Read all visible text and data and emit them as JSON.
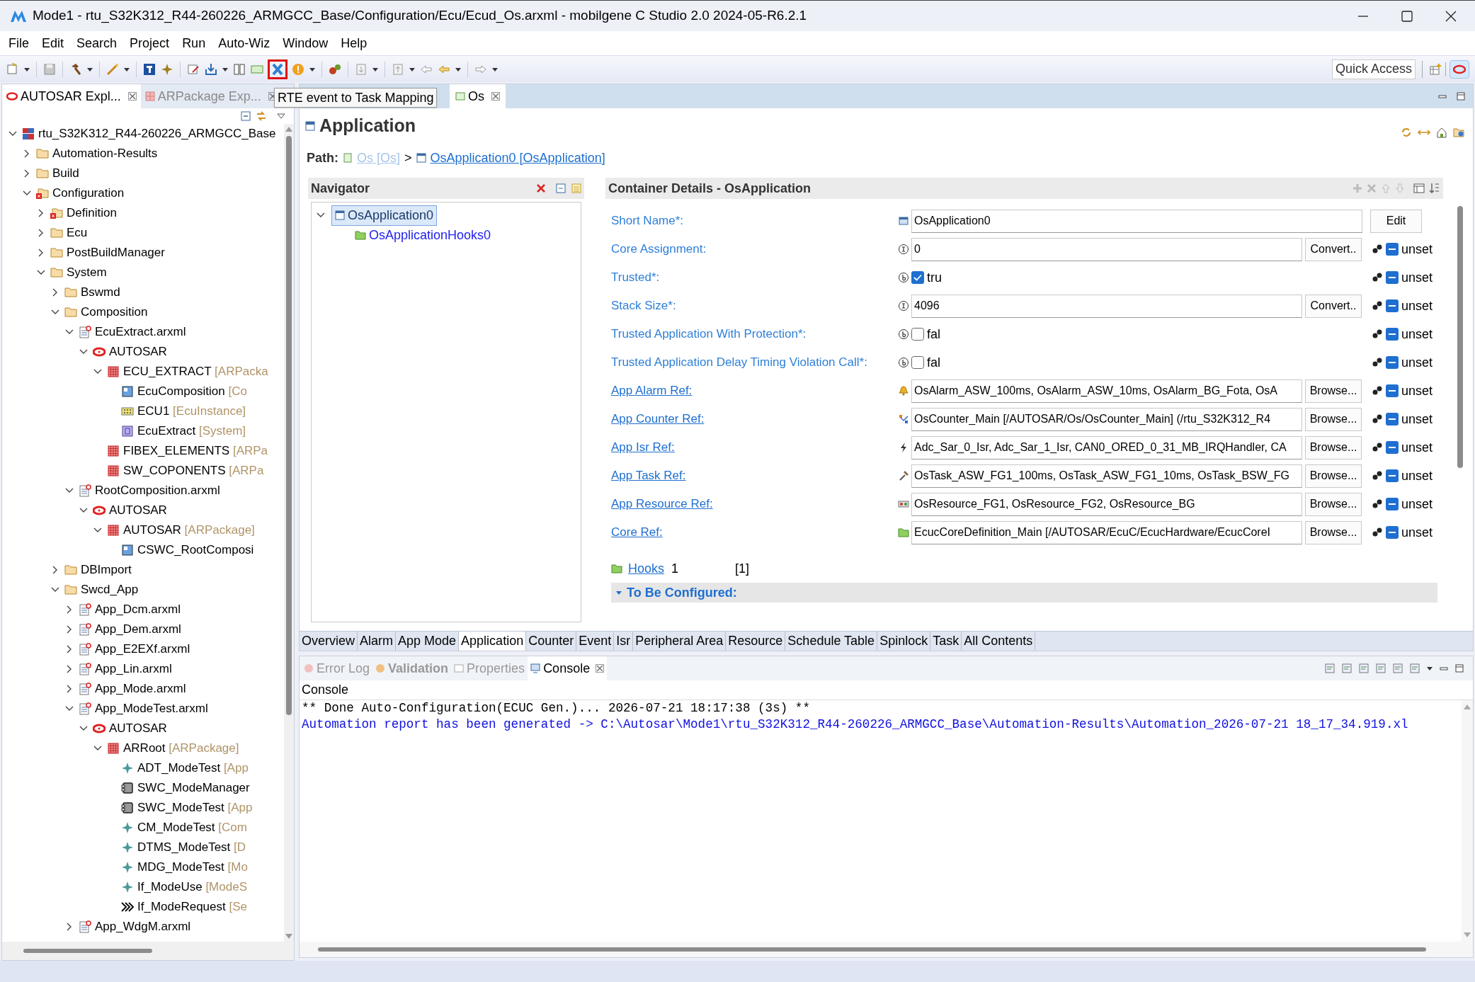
{
  "window": {
    "title": "Mode1 - rtu_S32K312_R44-260226_ARMGCC_Base/Configuration/Ecu/Ecud_Os.arxml - mobilgene C Studio 2.0 2024-05-R6.2.1"
  },
  "menu": [
    "File",
    "Edit",
    "Search",
    "Project",
    "Run",
    "Auto-Wiz",
    "Window",
    "Help"
  ],
  "toolbar": {
    "tooltip": "RTE event to Task Mapping",
    "mapping_tool_highlighted": true,
    "quick_access": "Quick Access"
  },
  "left_tabs": [
    {
      "label": "AUTOSAR Expl...",
      "selected": true
    },
    {
      "label": "ARPackage Exp...",
      "selected": false
    }
  ],
  "tree": [
    {
      "label": "rtu_S32K312_R44-260226_ARMGCC_Base",
      "kind": "project",
      "expanded": true,
      "children": [
        {
          "label": "Automation-Results",
          "kind": "folder",
          "expanded": false
        },
        {
          "label": "Build",
          "kind": "folder",
          "expanded": false
        },
        {
          "label": "Configuration",
          "kind": "folder-error",
          "expanded": true,
          "children": [
            {
              "label": "Definition",
              "kind": "folder-error",
              "expanded": false
            },
            {
              "label": "Ecu",
              "kind": "folder",
              "expanded": false
            },
            {
              "label": "PostBuildManager",
              "kind": "folder",
              "expanded": false
            },
            {
              "label": "System",
              "kind": "folder",
              "expanded": true,
              "children": [
                {
                  "label": "Bswmd",
                  "kind": "folder",
                  "expanded": false
                },
                {
                  "label": "Composition",
                  "kind": "folder",
                  "expanded": true,
                  "children": [
                    {
                      "label": "EcuExtract.arxml",
                      "kind": "file",
                      "expanded": true,
                      "children": [
                        {
                          "label": "AUTOSAR",
                          "kind": "autosar",
                          "expanded": true,
                          "children": [
                            {
                              "label": "ECU_EXTRACT",
                              "type": "[ARPacka",
                              "kind": "package",
                              "expanded": true,
                              "children": [
                                {
                                  "label": "EcuComposition",
                                  "type": "[Co",
                                  "kind": "composition"
                                },
                                {
                                  "label": "ECU1",
                                  "type": "[EcuInstance]",
                                  "kind": "ecu"
                                },
                                {
                                  "label": "EcuExtract",
                                  "type": "[System]",
                                  "kind": "system"
                                }
                              ]
                            },
                            {
                              "label": "FIBEX_ELEMENTS",
                              "type": "[ARPa",
                              "kind": "package"
                            },
                            {
                              "label": "SW_COPONENTS",
                              "type": "[ARPa",
                              "kind": "package"
                            }
                          ]
                        }
                      ]
                    },
                    {
                      "label": "RootComposition.arxml",
                      "kind": "file",
                      "expanded": true,
                      "children": [
                        {
                          "label": "AUTOSAR",
                          "kind": "autosar",
                          "expanded": true,
                          "children": [
                            {
                              "label": "AUTOSAR",
                              "type": "[ARPackage]",
                              "kind": "package",
                              "expanded": true,
                              "children": [
                                {
                                  "label": "CSWC_RootComposi",
                                  "kind": "composition"
                                }
                              ]
                            }
                          ]
                        }
                      ]
                    }
                  ]
                },
                {
                  "label": "DBImport",
                  "kind": "folder",
                  "expanded": false
                },
                {
                  "label": "Swcd_App",
                  "kind": "folder",
                  "expanded": true,
                  "children": [
                    {
                      "label": "App_Dcm.arxml",
                      "kind": "file",
                      "expanded": false
                    },
                    {
                      "label": "App_Dem.arxml",
                      "kind": "file",
                      "expanded": false
                    },
                    {
                      "label": "App_E2EXf.arxml",
                      "kind": "file",
                      "expanded": false
                    },
                    {
                      "label": "App_Lin.arxml",
                      "kind": "file",
                      "expanded": false
                    },
                    {
                      "label": "App_Mode.arxml",
                      "kind": "file",
                      "expanded": false
                    },
                    {
                      "label": "App_ModeTest.arxml",
                      "kind": "file",
                      "expanded": true,
                      "children": [
                        {
                          "label": "AUTOSAR",
                          "kind": "autosar",
                          "expanded": true,
                          "children": [
                            {
                              "label": "ARRoot",
                              "type": "[ARPackage]",
                              "kind": "package",
                              "expanded": true,
                              "children": [
                                {
                                  "label": "ADT_ModeTest",
                                  "type": "[App",
                                  "kind": "element"
                                },
                                {
                                  "label": "SWC_ModeManager",
                                  "kind": "component"
                                },
                                {
                                  "label": "SWC_ModeTest",
                                  "type": "[App",
                                  "kind": "component"
                                },
                                {
                                  "label": "CM_ModeTest",
                                  "type": "[Com",
                                  "kind": "element"
                                },
                                {
                                  "label": "DTMS_ModeTest",
                                  "type": "[D",
                                  "kind": "element"
                                },
                                {
                                  "label": "MDG_ModeTest",
                                  "type": "[Mo",
                                  "kind": "element"
                                },
                                {
                                  "label": "If_ModeUse",
                                  "type": "[ModeS",
                                  "kind": "element"
                                },
                                {
                                  "label": "If_ModeRequest",
                                  "type": "[Se",
                                  "kind": "interface"
                                }
                              ]
                            }
                          ]
                        }
                      ]
                    },
                    {
                      "label": "App_WdgM.arxml",
                      "kind": "file",
                      "expanded": false
                    }
                  ]
                }
              ]
            }
          ]
        }
      ]
    }
  ],
  "editor_tabs": [
    {
      "label": "Os",
      "selected": true
    }
  ],
  "page": {
    "title": "Application",
    "path_label": "Path:",
    "separator": ">",
    "path": [
      {
        "label": "Os [Os]",
        "disabled": true
      },
      {
        "label": "OsApplication0 [OsApplication]",
        "disabled": false
      }
    ]
  },
  "navigator": {
    "title": "Navigator",
    "items": [
      {
        "label": "OsApplication0",
        "selected": true,
        "expanded": true,
        "children": [
          {
            "label": "OsApplicationHooks0",
            "selected": false
          }
        ]
      }
    ]
  },
  "details": {
    "title": "Container Details - OsApplication",
    "fields": [
      {
        "kind": "name",
        "label": "Short Name*:",
        "value": "OsApplication0",
        "button": "Edit"
      },
      {
        "kind": "number",
        "label": "Core Assignment:",
        "value": "0",
        "button": "Convert..",
        "unset": "unset"
      },
      {
        "kind": "boolean",
        "label": "Trusted*:",
        "checked": true,
        "value": "tru",
        "unset": "unset"
      },
      {
        "kind": "number",
        "label": "Stack Size*:",
        "value": "4096",
        "button": "Convert..",
        "unset": "unset"
      },
      {
        "kind": "boolean",
        "label": "Trusted Application With Protection*:",
        "checked": false,
        "value": "fal",
        "unset": "unset"
      },
      {
        "kind": "boolean",
        "label": "Trusted Application Delay Timing Violation Call*:",
        "checked": false,
        "value": "fal",
        "unset": "unset"
      },
      {
        "kind": "alarm-ref",
        "label": "App Alarm Ref:",
        "value": "OsAlarm_ASW_100ms, OsAlarm_ASW_10ms, OsAlarm_BG_Fota, OsA",
        "button": "Browse...",
        "unset": "unset"
      },
      {
        "kind": "counter-ref",
        "label": "App Counter Ref:",
        "value": "OsCounter_Main [/AUTOSAR/Os/OsCounter_Main] (/rtu_S32K312_R4",
        "button": "Browse...",
        "unset": "unset"
      },
      {
        "kind": "isr-ref",
        "label": "App Isr Ref:",
        "value": "Adc_Sar_0_Isr, Adc_Sar_1_Isr, CAN0_ORED_0_31_MB_IRQHandler, CA",
        "button": "Browse...",
        "unset": "unset"
      },
      {
        "kind": "task-ref",
        "label": "App Task Ref:",
        "value": "OsTask_ASW_FG1_100ms, OsTask_ASW_FG1_10ms, OsTask_BSW_FG",
        "button": "Browse...",
        "unset": "unset"
      },
      {
        "kind": "resource-ref",
        "label": "App Resource Ref:",
        "value": "OsResource_FG1, OsResource_FG2, OsResource_BG",
        "button": "Browse...",
        "unset": "unset"
      },
      {
        "kind": "core-ref",
        "label": "Core Ref:",
        "value": "EcucCoreDefinition_Main [/AUTOSAR/EcuC/EcucHardware/EcucCoreI",
        "button": "Browse...",
        "unset": "unset"
      }
    ],
    "hooks": {
      "label": "Hooks",
      "count": "1",
      "multiplicity": "[1]"
    },
    "section": {
      "label": "To Be Configured:",
      "expanded": true
    }
  },
  "bottom_tabs": [
    {
      "label": "Overview",
      "selected": false
    },
    {
      "label": "Alarm",
      "selected": false
    },
    {
      "label": "App Mode",
      "selected": false
    },
    {
      "label": "Application",
      "selected": true
    },
    {
      "label": "Counter",
      "selected": false
    },
    {
      "label": "Event",
      "selected": false
    },
    {
      "label": "Isr",
      "selected": false
    },
    {
      "label": "Peripheral Area",
      "selected": false
    },
    {
      "label": "Resource",
      "selected": false
    },
    {
      "label": "Schedule Table",
      "selected": false
    },
    {
      "label": "Spinlock",
      "selected": false
    },
    {
      "label": "Task",
      "selected": false
    },
    {
      "label": "All Contents",
      "selected": false
    }
  ],
  "console": {
    "tabs": [
      {
        "label": "Error Log",
        "selected": false,
        "emphasis": false
      },
      {
        "label": "Validation",
        "selected": false,
        "emphasis": true
      },
      {
        "label": "Properties",
        "selected": false,
        "emphasis": false
      },
      {
        "label": "Console",
        "selected": true,
        "emphasis": false
      }
    ],
    "title": "Console",
    "lines": [
      {
        "kind": "normal",
        "text": "** Done Auto-Configuration(ECUC Gen.)... 2026-07-21 18:17:38 (3s) **"
      },
      {
        "kind": "info",
        "text": "Automation report has been generated -> C:\\Autosar\\Mode1\\rtu_S32K312_R44-260226_ARMGCC_Base\\Automation-Results\\Automation_2026-07-21 18_17_34.919.xl"
      }
    ]
  }
}
